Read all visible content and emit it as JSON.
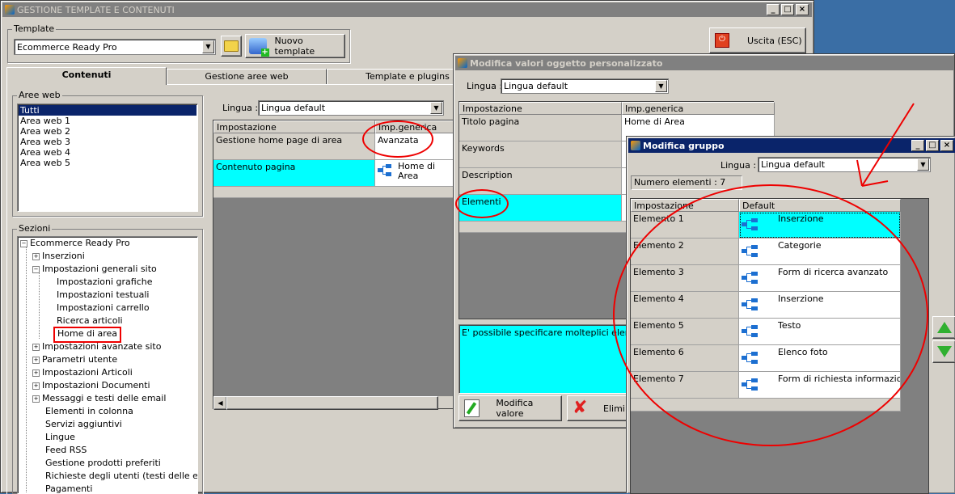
{
  "main_window": {
    "title": "GESTIONE TEMPLATE E CONTENUTI",
    "template_group_label": "Template",
    "template_selected": "Ecommerce Ready Pro",
    "new_template_button": "Nuovo template",
    "exit_button": "Uscita (ESC)",
    "tabs": [
      "Contenuti",
      "Gestione aree web",
      "Template e plugins"
    ],
    "areas_label": "Aree web",
    "areas": [
      "Tutti",
      "Area web 1",
      "Area web 2",
      "Area web 3",
      "Area web 4",
      "Area web 5"
    ],
    "sections_label": "Sezioni",
    "tree": [
      {
        "label": "Ecommerce Ready Pro",
        "pm": "-"
      },
      {
        "label": "Inserzioni",
        "pm": "+"
      },
      {
        "label": "Impostazioni generali sito",
        "pm": "-"
      },
      {
        "label": "Impostazioni grafiche",
        "pm": ""
      },
      {
        "label": "Impostazioni testuali",
        "pm": ""
      },
      {
        "label": "Impostazioni carrello",
        "pm": ""
      },
      {
        "label": "Ricerca articoli",
        "pm": ""
      },
      {
        "label": "Home di area",
        "pm": ""
      },
      {
        "label": "Impostazioni avanzate sito",
        "pm": "+"
      },
      {
        "label": "Parametri utente",
        "pm": "+"
      },
      {
        "label": "Impostazioni Articoli",
        "pm": "+"
      },
      {
        "label": "Impostazioni Documenti",
        "pm": "+"
      },
      {
        "label": "Messaggi e testi delle email",
        "pm": "+"
      },
      {
        "label": "Elementi in colonna",
        "pm": ""
      },
      {
        "label": "Servizi aggiuntivi",
        "pm": ""
      },
      {
        "label": "Lingue",
        "pm": ""
      },
      {
        "label": "Feed RSS",
        "pm": ""
      },
      {
        "label": "Gestione prodotti preferiti",
        "pm": ""
      },
      {
        "label": "Richieste degli utenti (testi delle email)",
        "pm": ""
      },
      {
        "label": "Pagamenti",
        "pm": ""
      }
    ],
    "lingua_label": "Lingua :",
    "lingua_value": "Lingua default",
    "grid_headers": [
      "Impostazione",
      "Imp.generica"
    ],
    "grid_rows": [
      {
        "setting": "Gestione home page di area",
        "value": "Avanzata"
      },
      {
        "setting": "Contenuto pagina",
        "value": "Home di Area"
      }
    ]
  },
  "custom_dialog": {
    "title": "Modifica valori oggetto personalizzato",
    "lingua_label": "Lingua :",
    "lingua_value": "Lingua default",
    "headers": [
      "Impostazione",
      "Imp.generica"
    ],
    "rows": [
      {
        "setting": "Titolo pagina",
        "value": "Home di Area"
      },
      {
        "setting": "Keywords",
        "value": ""
      },
      {
        "setting": "Description",
        "value": ""
      },
      {
        "setting": "Elementi",
        "value": ""
      }
    ],
    "description_text": "E' possibile specificare molteplici elementi a",
    "modify_button": "Modifica valore",
    "delete_button": "Elimi"
  },
  "group_dialog": {
    "title": "Modifica gruppo",
    "lingua_label": "Lingua :",
    "lingua_value": "Lingua default",
    "count_label": "Numero elementi : 7",
    "headers": [
      "Impostazione",
      "Default"
    ],
    "rows": [
      {
        "name": "Elemento 1",
        "value": "Inserzione"
      },
      {
        "name": "Elemento 2",
        "value": "Categorie"
      },
      {
        "name": "Elemento 3",
        "value": "Form di ricerca avanzato"
      },
      {
        "name": "Elemento 4",
        "value": "Inserzione"
      },
      {
        "name": "Elemento 5",
        "value": "Testo"
      },
      {
        "name": "Elemento 6",
        "value": "Elenco foto"
      },
      {
        "name": "Elemento 7",
        "value": "Form di richiesta informazioni"
      }
    ]
  },
  "colors": {
    "accent": "#0a246a",
    "highlight": "#00ffff",
    "annotation": "#e00000",
    "desktop": "#3a6ea5"
  }
}
